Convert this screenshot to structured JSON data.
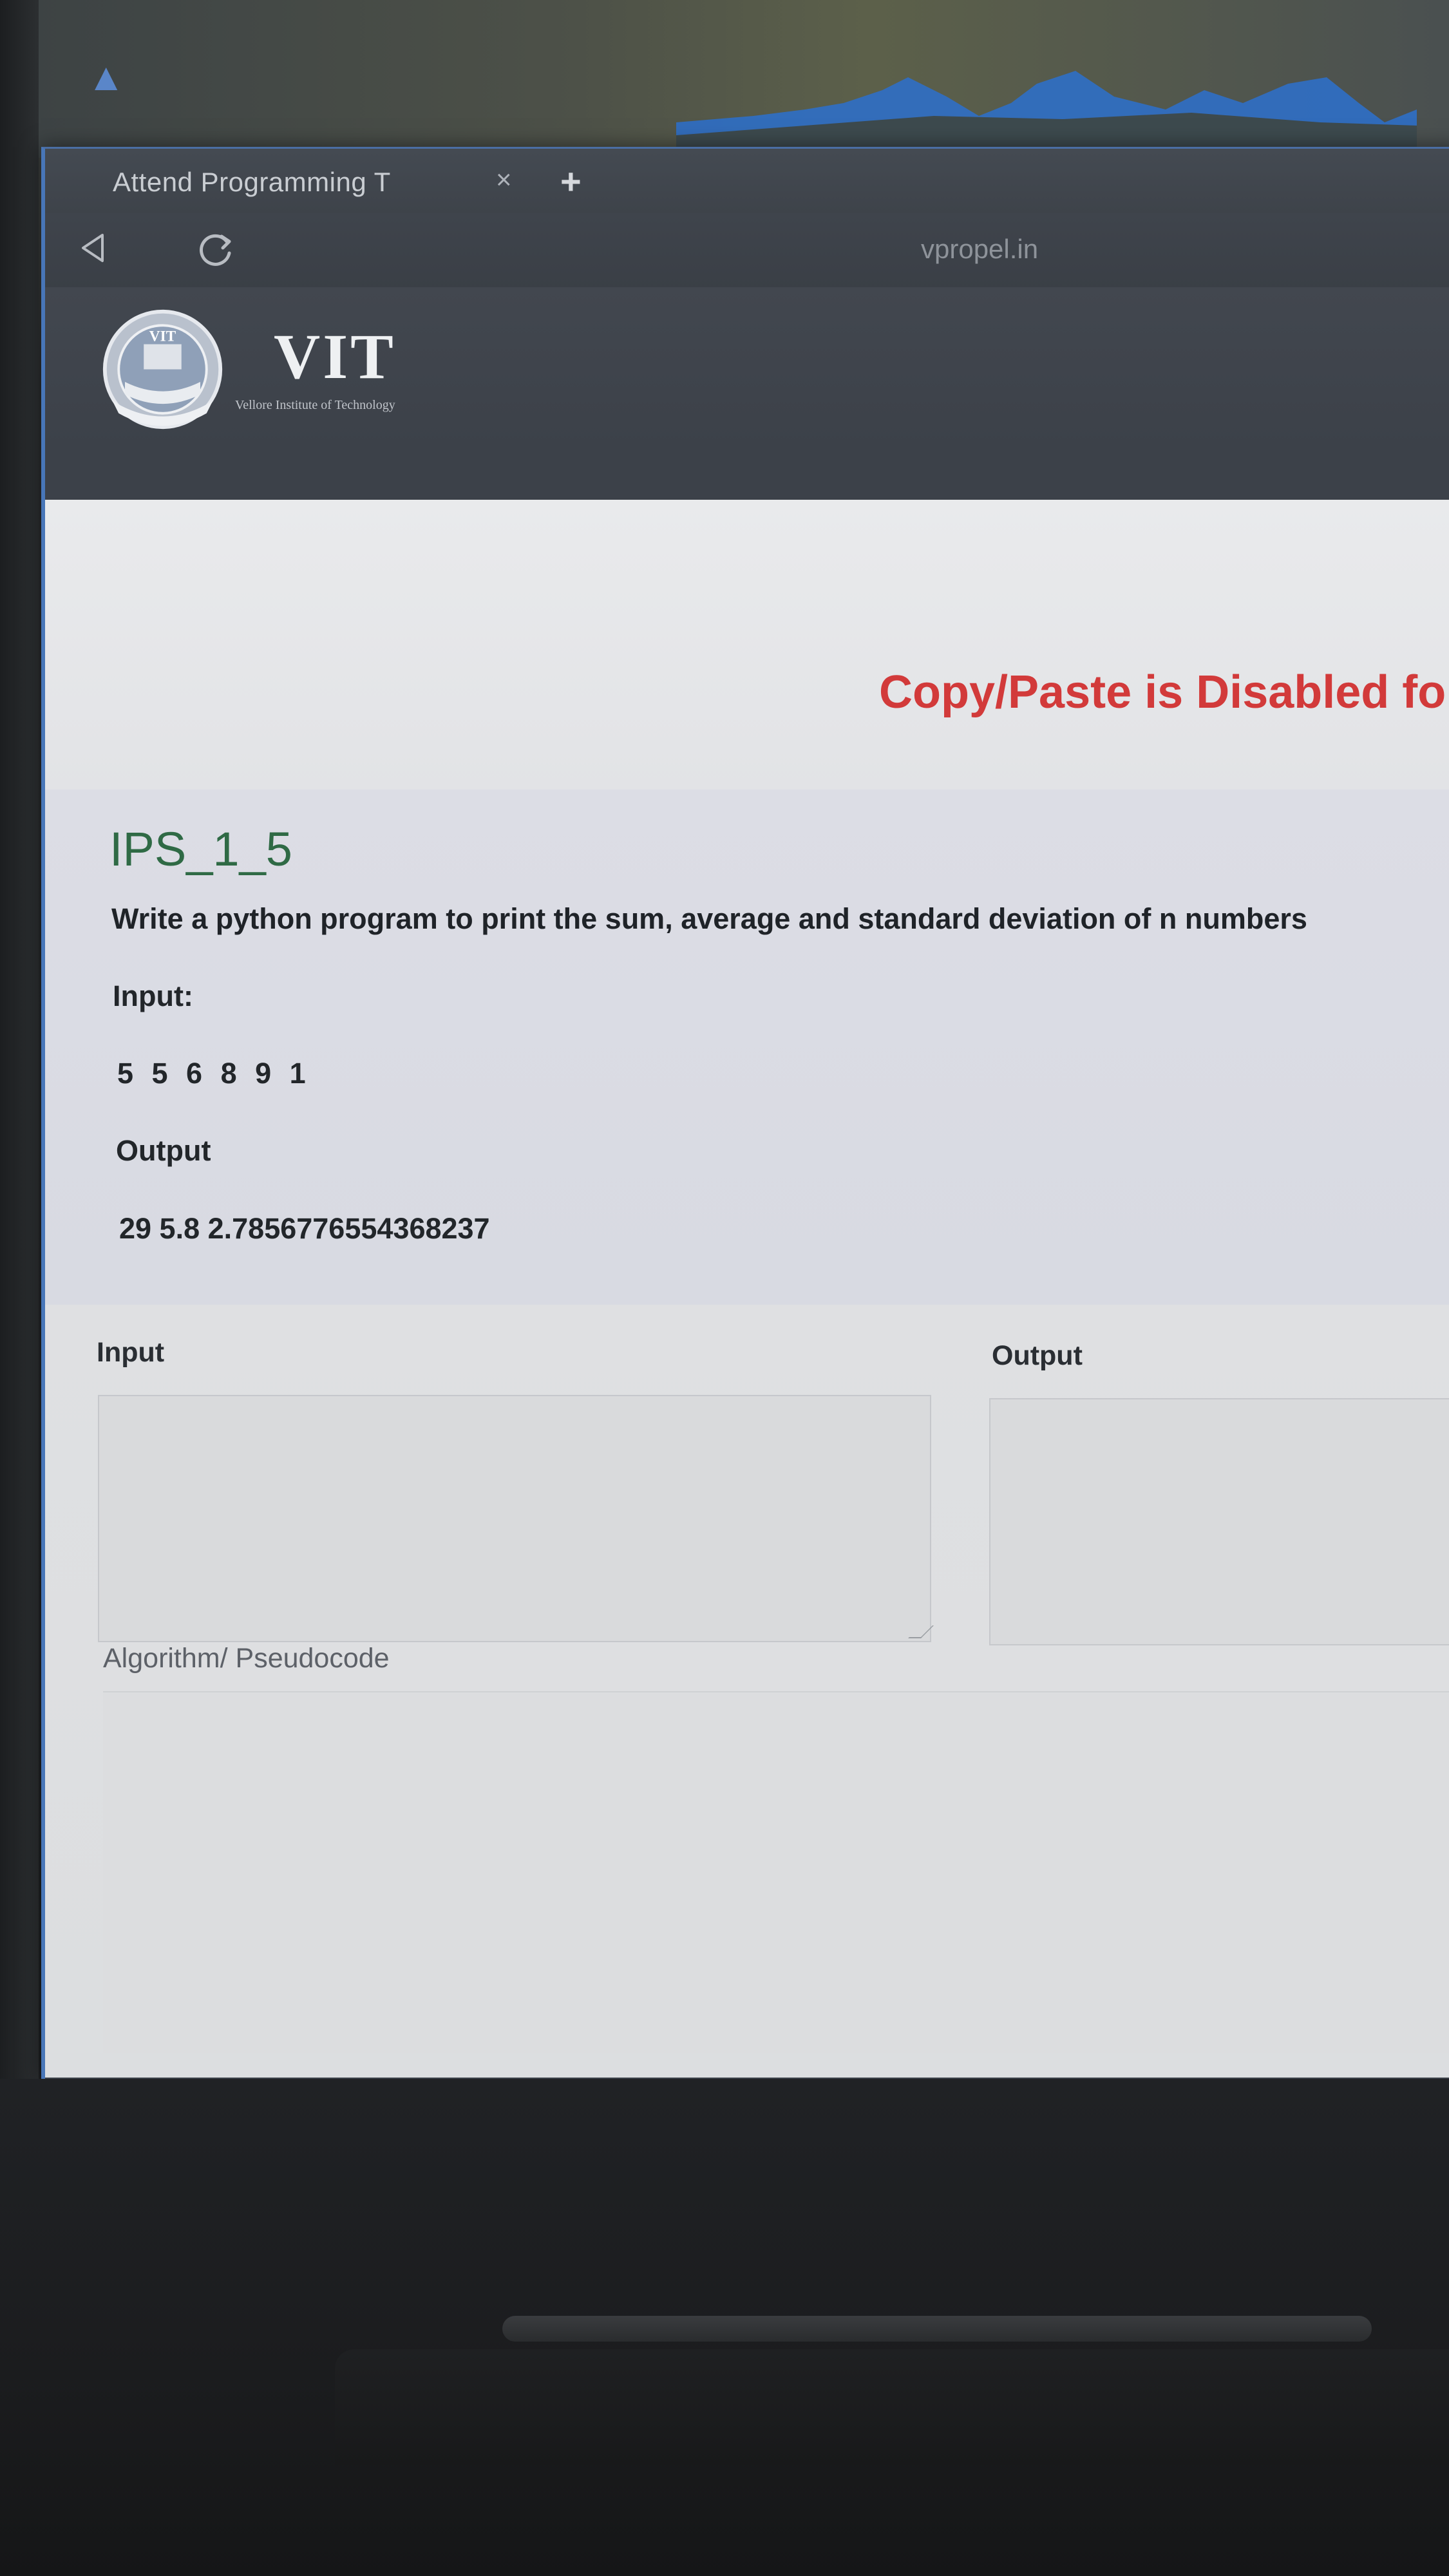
{
  "browser": {
    "tab_title": "Attend Programming T",
    "tab_close": "×",
    "new_tab": "+",
    "url": "vpropel.in"
  },
  "header": {
    "logo_text": "VIT",
    "logo_subtitle": "Vellore Institute of Technology",
    "seal_text": "VIT"
  },
  "notice": {
    "text": "Copy/Paste is Disabled for"
  },
  "question": {
    "title": "IPS_1_5",
    "description": "Write a python program to print the sum, average and standard deviation of n numbers",
    "input_label": "Input:",
    "input_value": "5 5 6 8 9 1",
    "output_label": "Output",
    "output_value": "29 5.8 2.7856776554368237"
  },
  "io": {
    "input_label": "Input",
    "output_label": "Output",
    "input_value": "",
    "output_value": ""
  },
  "algorithm": {
    "label": "Algorithm/ Pseudocode",
    "value": ""
  },
  "colors": {
    "notice": "#d23a3a",
    "title": "#2f6a45",
    "window_border": "#4876b8"
  }
}
